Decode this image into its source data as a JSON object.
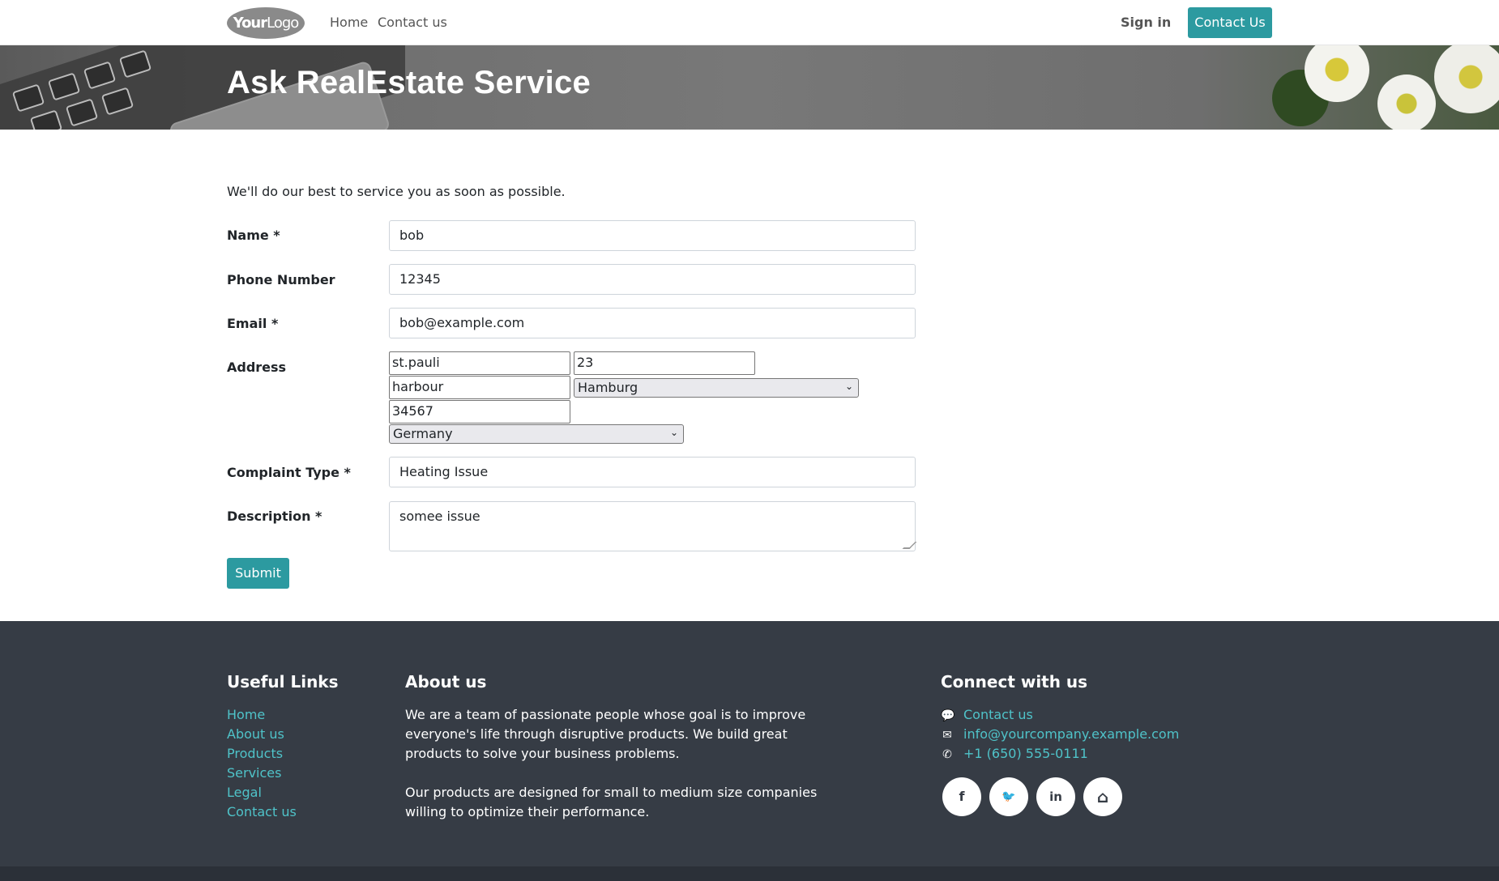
{
  "header": {
    "logo": {
      "bold": "Your",
      "thin": "Logo"
    },
    "nav": [
      {
        "label": "Home"
      },
      {
        "label": "Contact us"
      }
    ],
    "sign_in": "Sign in",
    "contact_button": "Contact Us"
  },
  "banner": {
    "title": "Ask RealEstate Service"
  },
  "form": {
    "intro": "We'll do our best to service you as soon as possible.",
    "name": {
      "label": "Name *",
      "value": "bob"
    },
    "phone": {
      "label": "Phone Number",
      "value": "12345"
    },
    "email": {
      "label": "Email *",
      "value": "bob@example.com"
    },
    "address": {
      "label": "Address",
      "street": "st.pauli",
      "number": "23",
      "district": "harbour",
      "city": "Hamburg",
      "zip": "34567",
      "country": "Germany"
    },
    "complaint_type": {
      "label": "Complaint Type *",
      "value": "Heating Issue"
    },
    "description": {
      "label": "Description *",
      "value": "somee issue"
    },
    "submit": "Submit"
  },
  "footer": {
    "useful_links": {
      "title": "Useful Links",
      "items": [
        "Home",
        "About us",
        "Products",
        "Services",
        "Legal",
        "Contact us"
      ]
    },
    "about": {
      "title": "About us",
      "p1": "We are a team of passionate people whose goal is to improve everyone's life through disruptive products. We build great products to solve your business problems.",
      "p2": "Our products are designed for small to medium size companies willing to optimize their performance."
    },
    "connect": {
      "title": "Connect with us",
      "contact": "Contact us",
      "email": "info@yourcompany.example.com",
      "phone": "+1 (650) 555-0111"
    },
    "social": [
      {
        "icon": "facebook-icon",
        "glyph": "f"
      },
      {
        "icon": "twitter-icon",
        "glyph": "🐦"
      },
      {
        "icon": "linkedin-icon",
        "glyph": "in"
      },
      {
        "icon": "home-icon",
        "glyph": "⌂"
      }
    ]
  },
  "colors": {
    "accent": "#2c9aa0",
    "footer_bg": "#363c45",
    "link": "#4fc3c9"
  }
}
